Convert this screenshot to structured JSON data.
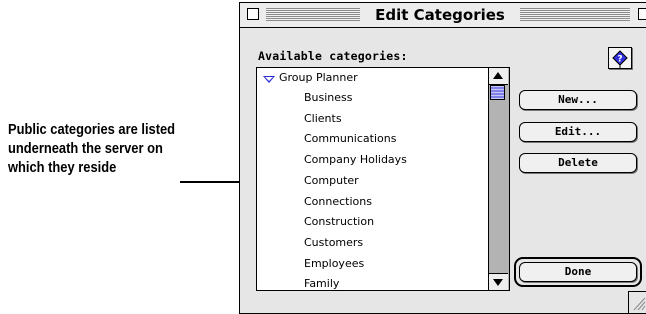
{
  "callout": {
    "line1": "Public categories are listed",
    "line2": "underneath the server on",
    "line3": "which they reside"
  },
  "window": {
    "title": "Edit Categories",
    "available_label": "Available categories:"
  },
  "list": {
    "parent": {
      "label": "Group Planner",
      "expanded": true
    },
    "items": [
      "Business",
      "Clients",
      "Communications",
      "Company Holidays",
      "Computer",
      "Connections",
      "Construction",
      "Customers",
      "Employees",
      "Family"
    ]
  },
  "buttons": {
    "new": "New...",
    "edit": "Edit...",
    "delete": "Delete",
    "done": "Done"
  },
  "icons": {
    "help": "balloon-help-icon",
    "close": "close-box-icon",
    "zoom": "zoom-box-icon",
    "grow": "size-box-icon"
  },
  "colors": {
    "accent": "#2a2ad6",
    "thumb": "#8080e8"
  }
}
